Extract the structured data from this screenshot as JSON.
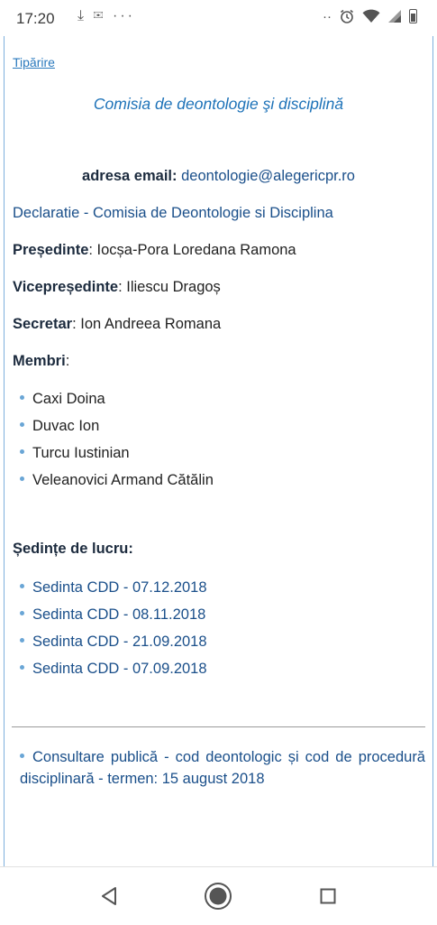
{
  "status_bar": {
    "time": "17:20",
    "left_icons": "⤓ ✉ ···",
    "right_icons": [
      "dots-icon",
      "alarm-icon",
      "wifi-icon",
      "signal-icon",
      "battery-icon"
    ]
  },
  "page": {
    "print_link": "Tipărire",
    "heading": "Comisia de deontologie şi disciplină",
    "email_label": "adresa email:",
    "email": "deontologie@alegericpr.ro",
    "declaration_link": "Declaratie - Comisia de Deontologie si Disciplina",
    "president_label": "Președinte",
    "president": "Iocșa-Pora Loredana Ramona",
    "vice_president_label": "Vicepreședinte",
    "vice_president": "Iliescu Dragoș",
    "secretary_label": "Secretar",
    "secretary": "Ion Andreea Romana",
    "members_label": "Membri",
    "members": [
      "Caxi Doina",
      "Duvac Ion",
      "Turcu Iustinian",
      "Veleanovici Armand Cătălin"
    ],
    "sessions_label": "Ședințe de lucru:",
    "sessions": [
      "Sedinta CDD - 07.12.2018",
      "Sedinta CDD - 08.11.2018",
      "Sedinta CDD - 21.09.2018",
      "Sedinta CDD - 07.09.2018"
    ],
    "consultation_link": "Consultare publică - cod deontologic și cod de procedură disciplinară - termen: 15 august 2018"
  },
  "nav_bar": [
    "back-icon",
    "home-icon",
    "recents-icon"
  ]
}
